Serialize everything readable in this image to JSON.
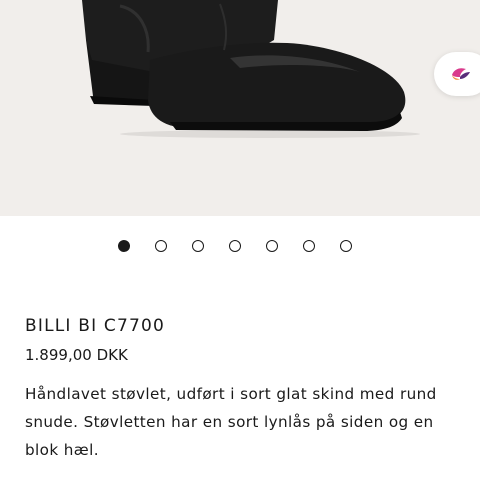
{
  "gallery": {
    "image_alt": "black-leather-ankle-boot",
    "dot_count": 7,
    "active_index": 0
  },
  "product": {
    "name": "BILLI BI C7700",
    "price": "1.899,00 DKK",
    "description": "Håndlavet støvlet, udført i sort glat skind med rund snude. Støvletten har en sort lynlås på siden og en blok hæl."
  },
  "colors": {
    "hero_bg": "#f1eeeb",
    "boot": "#1b1b1b",
    "badge_pink": "#d93a8c",
    "badge_orange": "#f08a3c",
    "badge_purple": "#5a2d7a"
  },
  "icons": {
    "floating_badge": "brand-bird-icon"
  }
}
